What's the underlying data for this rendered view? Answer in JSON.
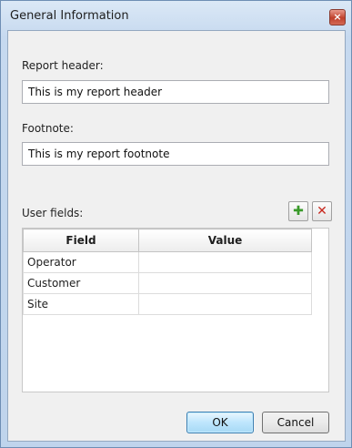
{
  "window": {
    "title": "General Information",
    "close_glyph": "×"
  },
  "report_header": {
    "label": "Report header:",
    "value": "This is my report header"
  },
  "footnote": {
    "label": "Footnote:",
    "value": "This is my report footnote"
  },
  "user_fields": {
    "label": "User fields:",
    "add_icon": "plus-icon",
    "add_glyph": "✚",
    "add_color": "#3a9a2a",
    "remove_icon": "delete-icon",
    "remove_glyph": "✕",
    "remove_color": "#c8281e",
    "columns": [
      "Field",
      "Value"
    ],
    "rows": [
      {
        "field": "Operator",
        "value": ""
      },
      {
        "field": "Customer",
        "value": ""
      },
      {
        "field": "Site",
        "value": ""
      }
    ]
  },
  "buttons": {
    "ok": "OK",
    "cancel": "Cancel"
  }
}
